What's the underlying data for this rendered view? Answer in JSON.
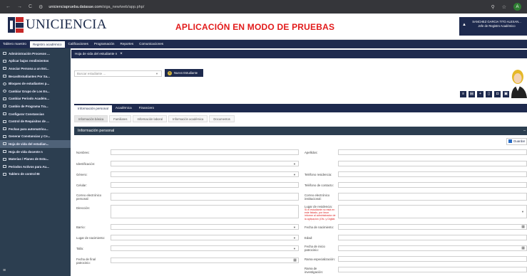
{
  "browser": {
    "url_host": "unicienciaprueba.datasae.com",
    "url_path": "/siga_new/web/app.php/",
    "profile_initial": "A"
  },
  "header": {
    "logo_text": "UNICIENCIA",
    "mode_banner": "APLICACIÓN EN MODO DE PRUEBAS",
    "user_name": "SANCHEZ GARCIA TITO ALEXAN...",
    "user_role": "Jefe de Registro Académico"
  },
  "menubar": {
    "items": [
      {
        "label": "Tablero maestro"
      },
      {
        "label": "Registro académico"
      },
      {
        "label": "Calificaciones"
      },
      {
        "label": "Programación"
      },
      {
        "label": "Reportes"
      },
      {
        "label": "Comunicaciones"
      }
    ]
  },
  "sidebar": {
    "items": [
      {
        "label": "Administración Procesos ..."
      },
      {
        "label": "Aplicar bajos rendimientos"
      },
      {
        "label": "Asociar Persona a un Est..."
      },
      {
        "label": "Becas/Estudiantes Por Sa..."
      },
      {
        "label": "Bloqueo de estudiantes p..."
      },
      {
        "label": "Cambiar Grupo de Los Es..."
      },
      {
        "label": "Cambiar Periodo Académ..."
      },
      {
        "label": "Cambio de Programa Tra..."
      },
      {
        "label": "Configurar Constancias"
      },
      {
        "label": "Control de Requisitos de ..."
      },
      {
        "label": "Fechas para automatrícu..."
      },
      {
        "label": "Generar Constancias y Ce..."
      },
      {
        "label": "Hoja de vida del estudian..."
      },
      {
        "label": "Hoja de vida docente n"
      },
      {
        "label": "Materias / Planes de Estu..."
      },
      {
        "label": "Periodos Activos para Au..."
      },
      {
        "label": "Tablero de control BI"
      }
    ]
  },
  "main": {
    "title": "Hoja de vida del estudiante n",
    "close_glyph": "×",
    "search_placeholder": "Buscar estudiante ...",
    "new_button": "Nuevo Estudiante",
    "tabs": [
      {
        "label": "Información personal"
      },
      {
        "label": "Académica"
      },
      {
        "label": "Financiero"
      }
    ],
    "subtabs": [
      {
        "label": "Información básica"
      },
      {
        "label": "Familiares"
      },
      {
        "label": "Información laboral"
      },
      {
        "label": "Información académica"
      },
      {
        "label": "Documentos"
      }
    ],
    "panel_title": "Información personal",
    "panel_toggle": "–",
    "save_button": "Guardar"
  },
  "form": {
    "left": [
      {
        "label": "Nombres:",
        "type": "text"
      },
      {
        "label": "Identificación:",
        "type": "select"
      },
      {
        "label": "Género:",
        "type": "select"
      },
      {
        "label": "Celular:",
        "type": "text"
      },
      {
        "label": "Correo electrónico personal:",
        "type": "text"
      },
      {
        "label": "Dirección:",
        "type": "text"
      },
      {
        "label": "Barrio:",
        "type": "select"
      },
      {
        "label": "Lugar de nacimiento:",
        "type": "select"
      },
      {
        "label": "Talla:",
        "type": "select"
      },
      {
        "label": "Fecha de final patrocinio:",
        "type": "date"
      }
    ],
    "right": [
      {
        "label": "Apellidos:",
        "type": "text"
      },
      {
        "label": "",
        "type": "text"
      },
      {
        "label": "Teléfono residencia:",
        "type": "text"
      },
      {
        "label": "Teléfono de contacto:",
        "type": "text"
      },
      {
        "label": "Correo electrónico institucional:",
        "type": "text"
      },
      {
        "label": "Lugar de residencia:",
        "type": "select",
        "note": "Si el estudiante no está en este listado, por favor informe al administrador de la aplicación (Ofc. y Digital se debe)."
      },
      {
        "label": "Fecha de nacimiento:",
        "type": "date"
      },
      {
        "label": "Edad:",
        "type": "text"
      },
      {
        "label": "Fecha de inicio patrocinio:",
        "type": "date"
      },
      {
        "label": "Rama especialización:",
        "type": "text"
      },
      {
        "label": "Rama de investigación:",
        "type": "text"
      }
    ]
  },
  "colors": {
    "navy": "#1e2a4e",
    "sidebar": "#2c3e50",
    "banner_red": "#e21b1b",
    "accent_gold": "#d8b73a"
  }
}
